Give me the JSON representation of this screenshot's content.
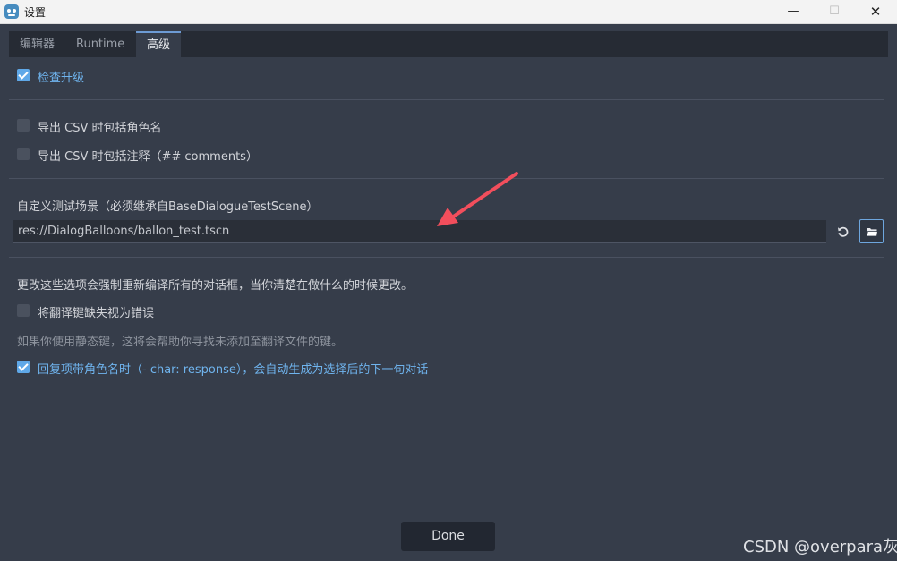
{
  "window": {
    "title": "设置",
    "minimize_glyph": "—",
    "maximize_glyph": "☐",
    "close_glyph": "✕"
  },
  "tabs": [
    {
      "label": "编辑器",
      "active": false
    },
    {
      "label": "Runtime",
      "active": false
    },
    {
      "label": "高级",
      "active": true
    }
  ],
  "settings": {
    "check_updates": {
      "label": "检查升级",
      "checked": true
    },
    "export_csv_character": {
      "label": "导出 CSV 时包括角色名",
      "checked": false
    },
    "export_csv_comments": {
      "label": "导出 CSV 时包括注释（## comments）",
      "checked": false
    },
    "custom_test_scene": {
      "label": "自定义测试场景（必须继承自BaseDialogueTestScene）",
      "value": "res://DialogBalloons/ballon_test.tscn"
    },
    "recompile_warning": "更改这些选项会强制重新编译所有的对话框，当你清楚在做什么的时候更改。",
    "missing_keys_as_errors": {
      "label": "将翻译键缺失视为错误",
      "checked": false
    },
    "static_keys_hint": "如果你使用静态键，这将会帮助你寻找未添加至翻译文件的键。",
    "auto_character_response": {
      "label": "回复项带角色名时（- char: response），会自动生成为选择后的下一句对话",
      "checked": true
    }
  },
  "footer": {
    "done_label": "Done"
  },
  "watermark": "CSDN @overpara灰",
  "colors": {
    "background": "#363d4a",
    "accent": "#5fa8e8",
    "annotation_arrow": "#f24e5c"
  },
  "icons": {
    "app": "godot-icon",
    "reset": "reset-icon",
    "folder": "folder-icon"
  }
}
